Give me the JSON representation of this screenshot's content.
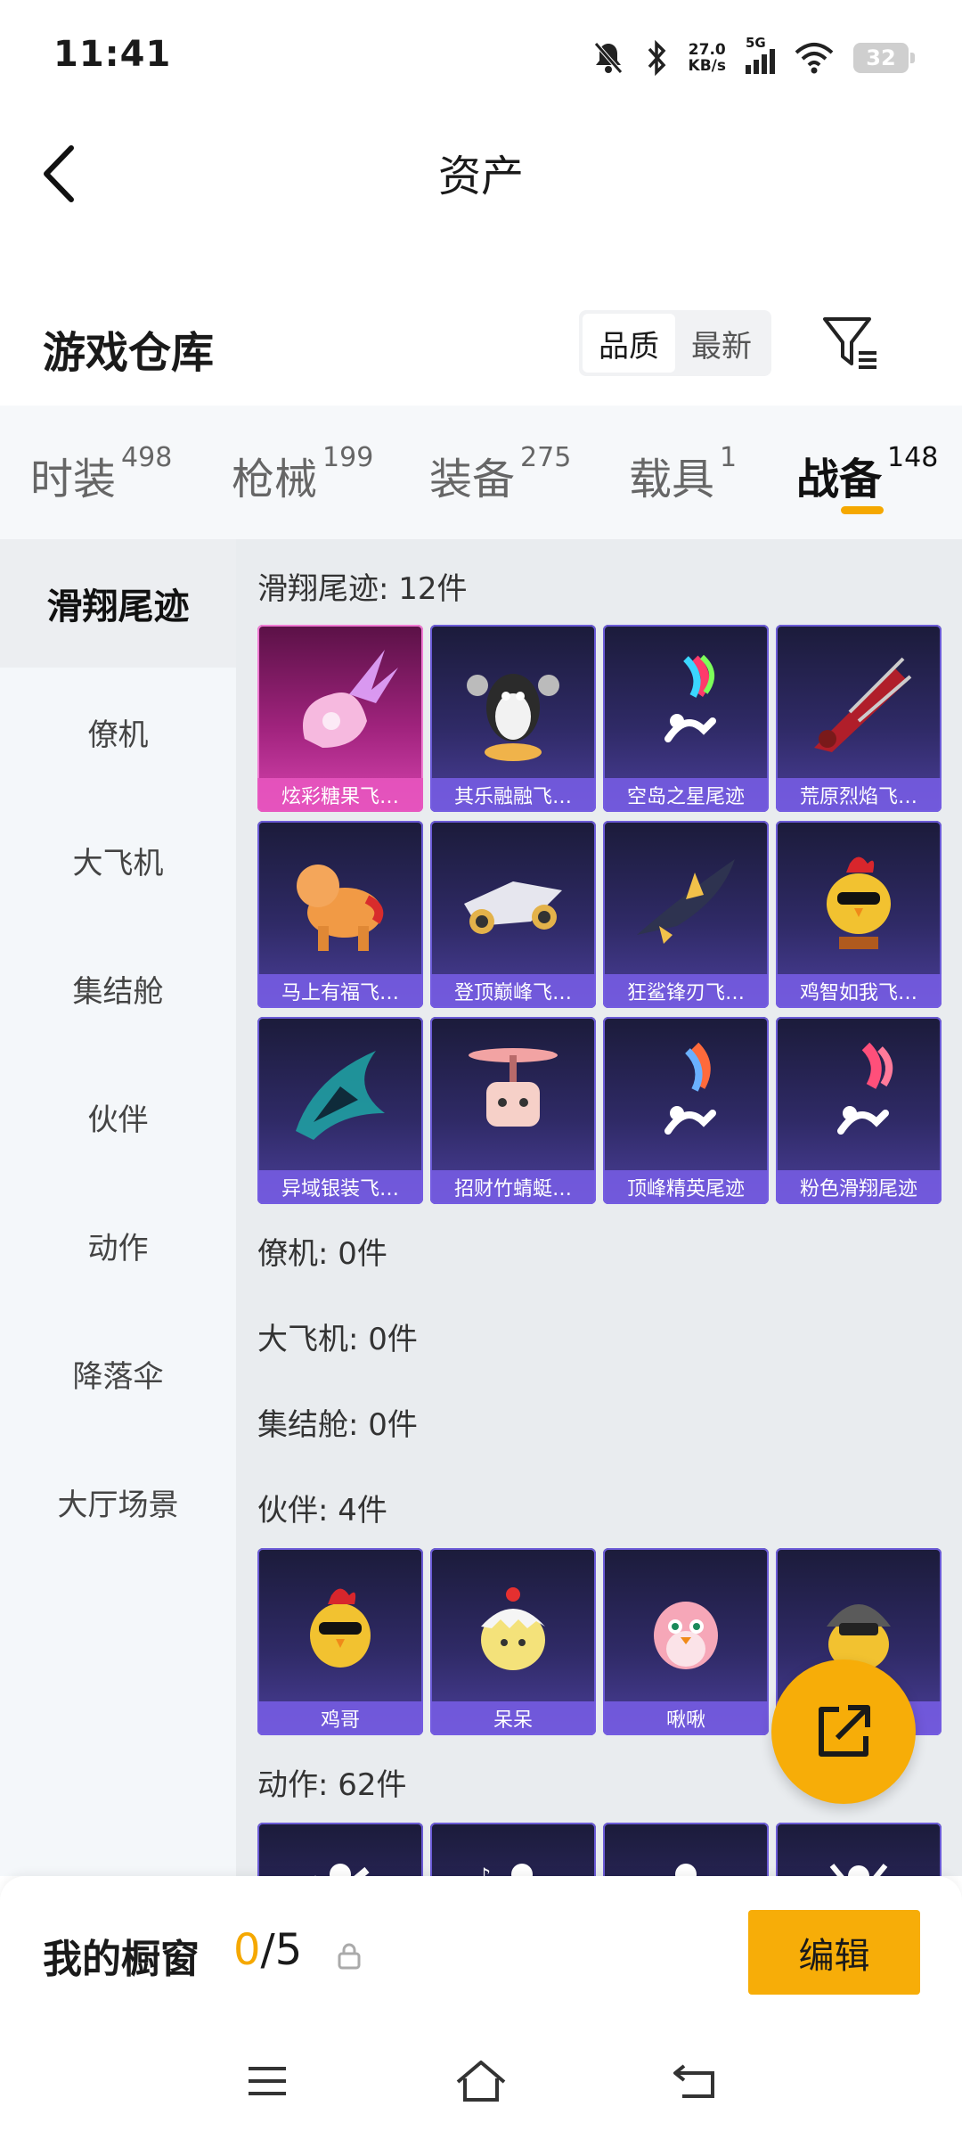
{
  "status": {
    "time": "11:41",
    "net_speed_value": "27.0",
    "net_speed_unit": "KB/s",
    "signal": "5G",
    "battery": "32"
  },
  "header": {
    "title": "资产"
  },
  "warehouse": {
    "title": "游戏仓库",
    "sort_quality": "品质",
    "sort_latest": "最新"
  },
  "tabs": [
    {
      "label": "时装",
      "count": "498"
    },
    {
      "label": "枪械",
      "count": "199"
    },
    {
      "label": "装备",
      "count": "275"
    },
    {
      "label": "载具",
      "count": "1"
    },
    {
      "label": "战备",
      "count": "148"
    }
  ],
  "side_nav": [
    "滑翔尾迹",
    "僚机",
    "大飞机",
    "集结舱",
    "伙伴",
    "动作",
    "降落伞",
    "大厅场景"
  ],
  "sections": {
    "trail_title": "滑翔尾迹: 12件",
    "trail_items": [
      "炫彩糖果飞…",
      "其乐融融飞…",
      "空岛之星尾迹",
      "荒原烈焰飞…",
      "马上有福飞…",
      "登顶巅峰飞…",
      "狂鲨锋刃飞…",
      "鸡智如我飞…",
      "异域银装飞…",
      "招财竹蜻蜓…",
      "顶峰精英尾迹",
      "粉色滑翔尾迹"
    ],
    "wingman_title": "僚机: 0件",
    "bigplane_title": "大飞机: 0件",
    "capsule_title": "集结舱: 0件",
    "partner_title": "伙伴: 4件",
    "partner_items": [
      "鸡哥",
      "呆呆",
      "啾啾",
      ""
    ],
    "emote_title": "动作: 62件"
  },
  "showcase": {
    "title": "我的橱窗",
    "current": "0",
    "total": "/5",
    "edit_label": "编辑"
  },
  "colors": {
    "accent": "#f7ad08",
    "card_purple": "#4b3f9a",
    "card_pink": "#d844b0"
  }
}
